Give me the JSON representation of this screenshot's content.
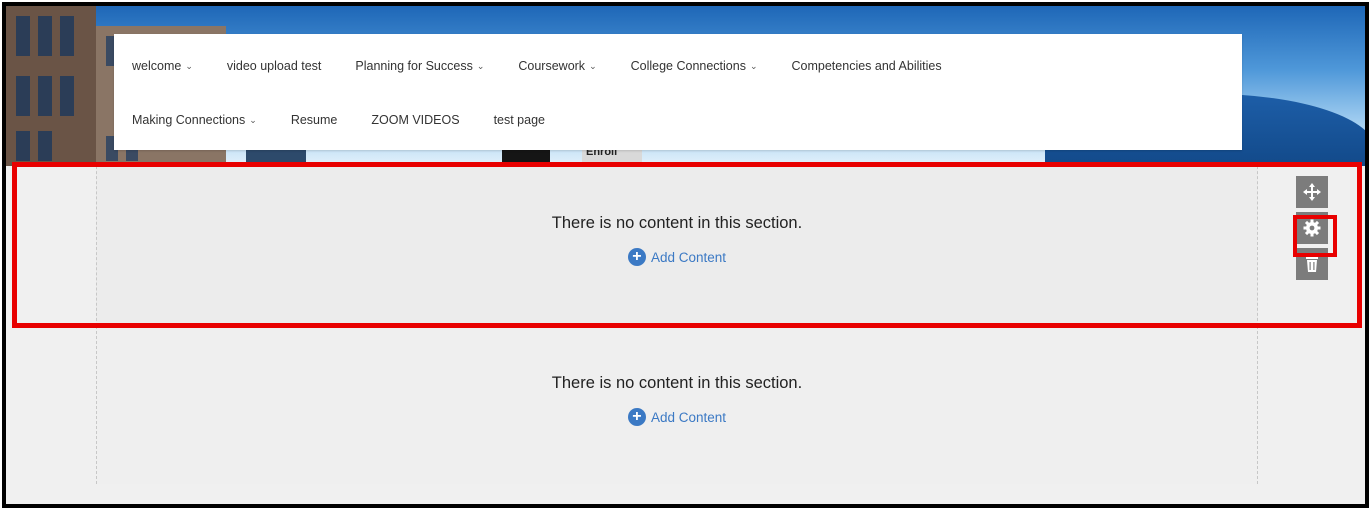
{
  "nav": {
    "row1": [
      {
        "label": "welcome",
        "dropdown": true
      },
      {
        "label": "video upload test",
        "dropdown": false
      },
      {
        "label": "Planning for Success",
        "dropdown": true
      },
      {
        "label": "Coursework",
        "dropdown": true
      },
      {
        "label": "College Connections",
        "dropdown": true
      },
      {
        "label": "Competencies and Abilities",
        "dropdown": false
      }
    ],
    "row2": [
      {
        "label": "Making Connections",
        "dropdown": true
      },
      {
        "label": "Resume",
        "dropdown": false
      },
      {
        "label": "ZOOM VIDEOS",
        "dropdown": false
      },
      {
        "label": "test page",
        "dropdown": false
      }
    ],
    "caret": "⌄"
  },
  "sections": [
    {
      "message": "There is no content in this section.",
      "add_label": "Add Content"
    },
    {
      "message": "There is no content in this section.",
      "add_label": "Add Content"
    }
  ],
  "banner": {
    "sign_text": "Enroll"
  },
  "toolbar": {
    "icons": [
      "move-icon",
      "gear-icon",
      "trash-icon"
    ]
  },
  "colors": {
    "highlight": "#e80000",
    "link": "#3b79c4",
    "tool_bg": "#7c7c7c"
  }
}
